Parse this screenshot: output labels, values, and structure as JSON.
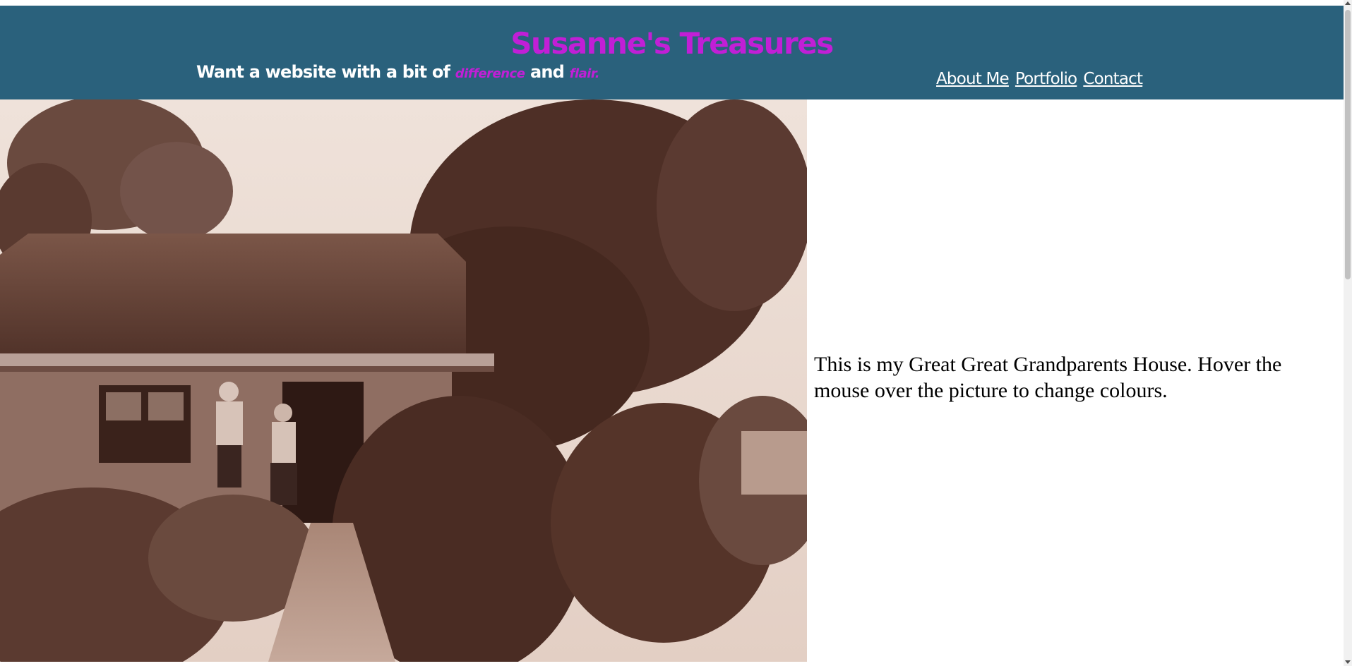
{
  "header": {
    "title": "Susanne's Treasures",
    "tagline": {
      "part1": "Want a website with a bit of ",
      "accent1": "difference",
      "part2": " and ",
      "accent2": "flair."
    },
    "nav": [
      {
        "label": "About Me"
      },
      {
        "label": "Portfolio"
      },
      {
        "label": "Contact"
      }
    ]
  },
  "main": {
    "caption": "This is my Great Great Grandparents House. Hover the mouse over the picture to change colours."
  },
  "colors": {
    "header_bg": "#2a617c",
    "title": "#c11fd6",
    "accent": "#c11fd6",
    "nav_text": "#ffffff",
    "photo_tone": "sepia"
  }
}
